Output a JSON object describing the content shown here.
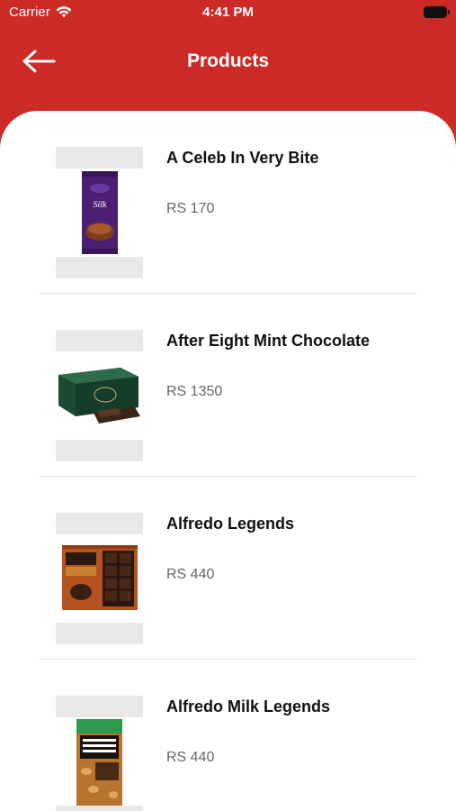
{
  "status_bar": {
    "carrier": "Carrier",
    "time": "4:41 PM"
  },
  "header": {
    "title": "Products"
  },
  "products": [
    {
      "name": "A Celeb In Very Bite",
      "price": "RS 170"
    },
    {
      "name": "After Eight Mint Chocolate",
      "price": "RS 1350"
    },
    {
      "name": "Alfredo Legends",
      "price": "RS 440"
    },
    {
      "name": "Alfredo Milk Legends",
      "price": "RS 440"
    }
  ],
  "colors": {
    "header_bg": "#cc2a26",
    "card_bg": "#ffffff",
    "placeholder": "#e8e8e8"
  },
  "icons": {
    "back": "arrow-left-icon",
    "wifi": "wifi-icon",
    "battery": "battery-icon"
  }
}
